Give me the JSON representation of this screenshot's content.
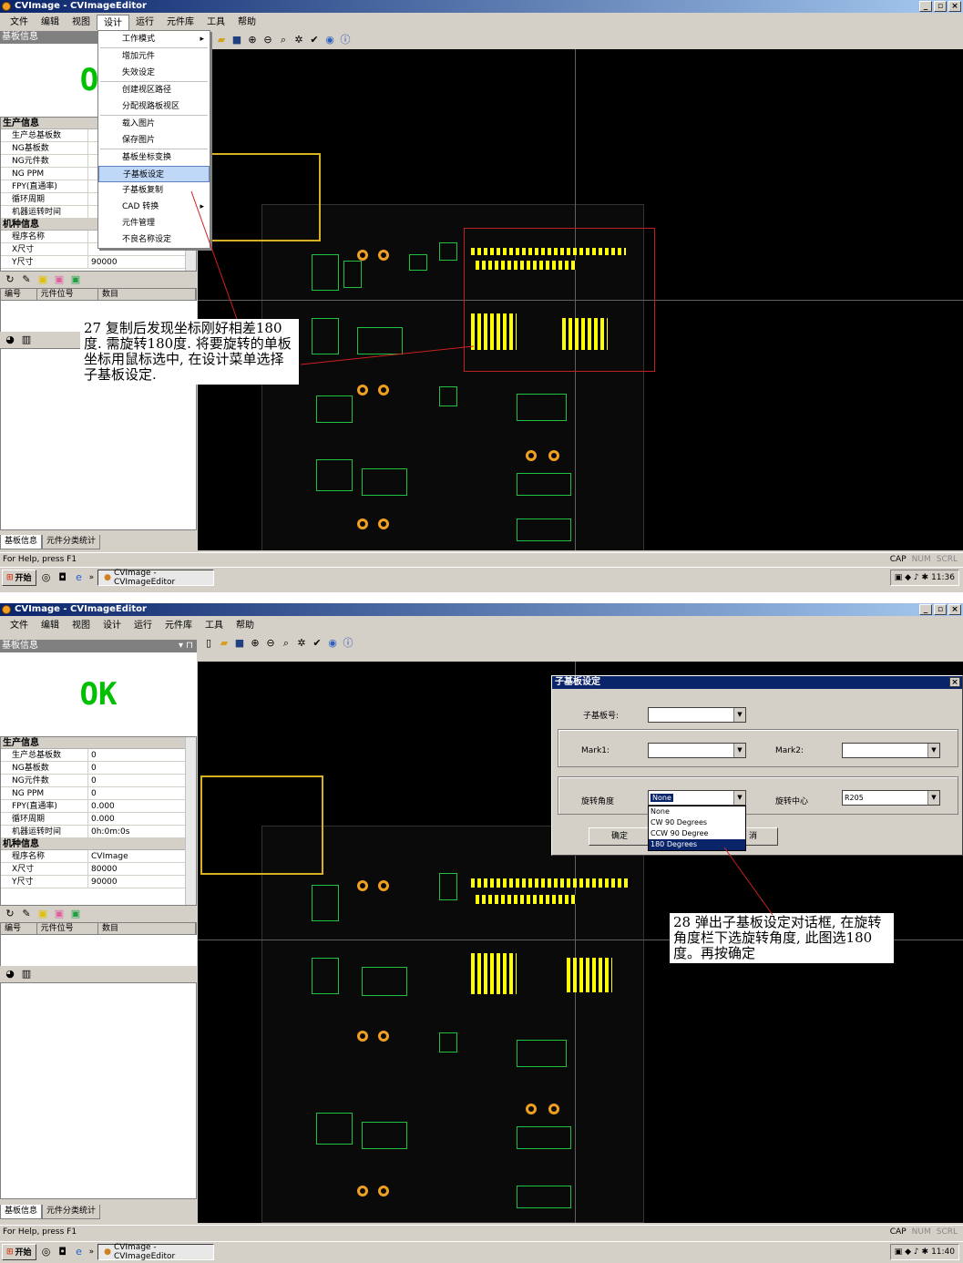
{
  "app": {
    "title": "CVImage - CVImageEditor",
    "taskbar_item": "CVImage - CVImageEditor",
    "start_label": "开始"
  },
  "menu": [
    "文件",
    "编辑",
    "视图",
    "设计",
    "运行",
    "元件库",
    "工具",
    "帮助"
  ],
  "left_panel": {
    "header": "基板信息",
    "ok_text": "OK",
    "ok_text_partial": "O",
    "section_production": "生产信息",
    "section_model": "机种信息",
    "production_rows": [
      {
        "key": "生产总基板数",
        "value": "0"
      },
      {
        "key": "NG基板数",
        "value": "0"
      },
      {
        "key": "NG元件数",
        "value": "0"
      },
      {
        "key": "NG PPM",
        "value": "0"
      },
      {
        "key": "FPY(直通率)",
        "value": "0.000"
      },
      {
        "key": "循环周期",
        "value": "0.000"
      },
      {
        "key": "机器运转时间",
        "value": "0h:0m:0s"
      }
    ],
    "model_rows": [
      {
        "key": "程序名称",
        "value": "CVImage"
      },
      {
        "key": "X尺寸",
        "value": "80000"
      },
      {
        "key": "Y尺寸",
        "value": "90000"
      }
    ],
    "list_headers": [
      "编号",
      "元件位号",
      "数目"
    ],
    "bottom_tabs": [
      "基板信息",
      "元件分类统计"
    ]
  },
  "design_menu": {
    "items": [
      {
        "label": "工作模式",
        "submenu": true
      },
      {
        "label": "增加元件"
      },
      {
        "label": "失效设定"
      },
      {
        "label": "创建视区路径"
      },
      {
        "label": "分配视路板视区"
      },
      {
        "label": "载入图片"
      },
      {
        "label": "保存图片"
      },
      {
        "label": "基板坐标变换"
      },
      {
        "label": "子基板设定",
        "selected": true
      },
      {
        "label": "子基板复制"
      },
      {
        "label": "CAD 转换",
        "submenu": true
      },
      {
        "label": "元件管理"
      },
      {
        "label": "不良名称设定"
      }
    ]
  },
  "status": {
    "help_text": "For Help, press F1",
    "caps": [
      "CAP",
      "NUM",
      "SCRL"
    ],
    "time1": "11:36",
    "time2": "11:40"
  },
  "annotations": {
    "step27": "27 复制后发现坐标刚好相差180度. 需旋转180度. 将要旋转的单板坐标用鼠标选中, 在设计菜单选择子基板设定.",
    "step28": "28 弹出子基板设定对话框, 在旋转角度栏下选旋转角度, 此图选180度。再按确定"
  },
  "dialog": {
    "title": "子基板设定",
    "sub_board_label": "子基板号:",
    "mark1_label": "Mark1:",
    "mark2_label": "Mark2:",
    "rotation_label": "旋转角度",
    "rotation_value": "None",
    "rotation_center_label": "旋转中心",
    "rotation_center_value": "R205",
    "rotation_options": [
      "None",
      "CW 90 Degrees",
      "CCW 90 Degree",
      "180 Degrees"
    ],
    "rotation_selected": "180 Degrees",
    "ok_label": "确定",
    "cancel_label": "取消",
    "cancel_label_visible": "消"
  },
  "colors": {
    "ok_green": "#00c000",
    "title_blue": "#0a246a",
    "highlight_yellow": "#ffff00",
    "selection_red": "#c02020"
  }
}
